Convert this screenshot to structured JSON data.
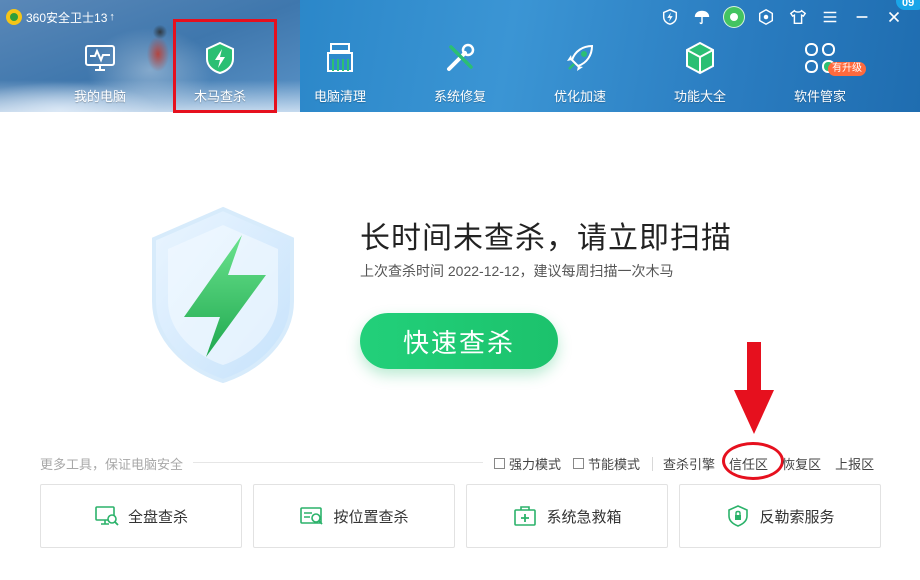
{
  "window": {
    "title": "360安全卫士13",
    "upgrade_arrow": "↑",
    "corner_badge": "09"
  },
  "nav": {
    "items": [
      {
        "label": "我的电脑",
        "icon": "monitor-pulse-icon"
      },
      {
        "label": "木马查杀",
        "icon": "shield-lightning-icon",
        "active": true
      },
      {
        "label": "电脑清理",
        "icon": "broom-icon"
      },
      {
        "label": "系统修复",
        "icon": "wrench-screwdriver-icon"
      },
      {
        "label": "优化加速",
        "icon": "rocket-icon"
      },
      {
        "label": "功能大全",
        "icon": "cube-icon"
      },
      {
        "label": "软件管家",
        "icon": "apps-flower-icon",
        "badge": "有升级"
      }
    ]
  },
  "hero": {
    "title": "长时间未查杀，请立即扫描",
    "subtitle": "上次查杀时间 2022-12-12，建议每周扫描一次木马",
    "scan_button": "快速查杀"
  },
  "tools": {
    "caption": "更多工具，保证电脑安全",
    "modes": [
      {
        "label": "强力模式",
        "checked": false
      },
      {
        "label": "节能模式",
        "checked": false
      }
    ],
    "links": [
      "查杀引擎",
      "信任区",
      "恢复区",
      "上报区"
    ],
    "cards": [
      {
        "label": "全盘查杀",
        "icon": "monitor-scan-icon"
      },
      {
        "label": "按位置查杀",
        "icon": "folder-scan-icon"
      },
      {
        "label": "系统急救箱",
        "icon": "first-aid-kit-icon"
      },
      {
        "label": "反勒索服务",
        "icon": "shield-lock-icon"
      }
    ]
  },
  "colors": {
    "header_blue": "#2a86c8",
    "scan_green": "#22d07a",
    "annotation_red": "#e6101e"
  }
}
